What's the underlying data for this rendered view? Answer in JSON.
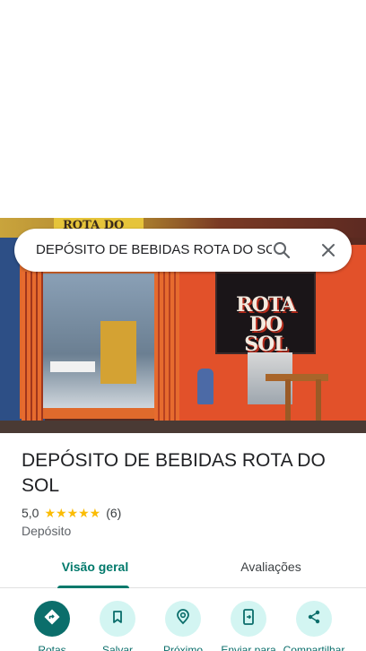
{
  "search": {
    "query": "DEPÓSITO DE BEBIDAS ROTA DO SOL",
    "search_icon": "search-icon",
    "close_icon": "close-icon"
  },
  "photo": {
    "sign_top_text": "ROTA DO",
    "sign_line1": "ROTA DO",
    "sign_line2": "SOL"
  },
  "place": {
    "title": "DEPÓSITO DE BEBIDAS ROTA DO SOL",
    "rating": "5,0",
    "stars": "★★★★★",
    "review_count": "(6)",
    "category": "Depósito"
  },
  "tabs": [
    {
      "label": "Visão geral",
      "active": true
    },
    {
      "label": "Avaliações",
      "active": false
    }
  ],
  "actions": [
    {
      "label": "Rotas",
      "icon": "directions-icon"
    },
    {
      "label": "Salvar",
      "icon": "bookmark-icon"
    },
    {
      "label": "Próximo",
      "icon": "nearby-icon"
    },
    {
      "label": "Enviar para",
      "icon": "send-to-phone-icon"
    },
    {
      "label": "Compartilhar",
      "icon": "share-icon"
    }
  ],
  "colors": {
    "accent": "#00796b",
    "primary_button": "#0b6e6b",
    "secondary_button": "#d3f5f2",
    "star": "#fbbc04"
  }
}
